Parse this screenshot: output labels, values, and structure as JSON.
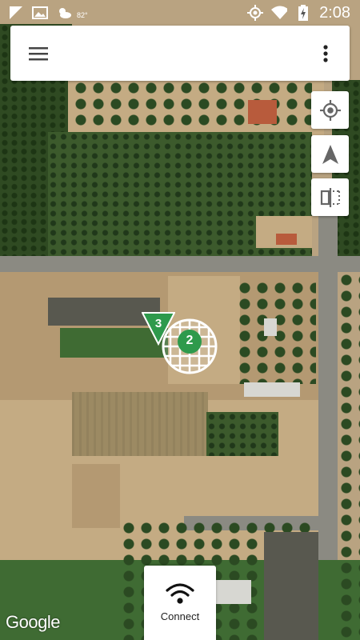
{
  "status_bar": {
    "temperature": "82°",
    "time": "2:08"
  },
  "top_bar": {
    "menu_icon": "hamburger-menu-icon",
    "overflow_icon": "more-vert-icon"
  },
  "map_controls": {
    "locate_icon": "gps-fixed-icon",
    "navigation_icon": "navigation-arrow-icon",
    "compare_icon": "flip-compare-icon"
  },
  "markers": {
    "triangle_label": "3",
    "circle_label": "2",
    "color": "#2e9a4c"
  },
  "connect": {
    "label": "Connect",
    "icon": "wifi-icon"
  },
  "map_attribution": "Google"
}
